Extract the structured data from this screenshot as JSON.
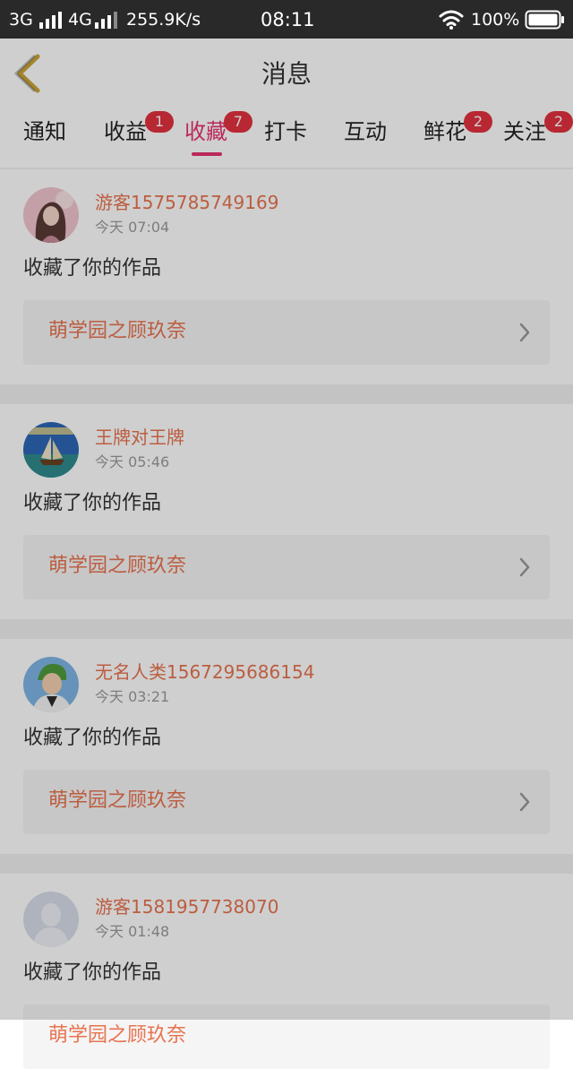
{
  "status_bar": {
    "network_1": "3G",
    "network_2": "4G",
    "speed": "255.9K/s",
    "time": "08:11",
    "battery": "100%"
  },
  "header": {
    "title": "消息",
    "back_icon": "chevron-left-icon"
  },
  "tabs": [
    {
      "label": "通知",
      "badge": "",
      "active": false
    },
    {
      "label": "收益",
      "badge": "1",
      "active": false
    },
    {
      "label": "收藏",
      "badge": "7",
      "active": true
    },
    {
      "label": "打卡",
      "badge": "",
      "active": false
    },
    {
      "label": "互动",
      "badge": "",
      "active": false
    },
    {
      "label": "鲜花",
      "badge": "2",
      "active": false
    },
    {
      "label": "关注",
      "badge": "2",
      "active": false
    }
  ],
  "notifications": [
    {
      "user": "游客1575785749169",
      "time": "今天 07:04",
      "action": "收藏了你的作品",
      "work": "萌学园之顾玖奈",
      "avatar": "girl-photo-avatar"
    },
    {
      "user": "王牌对王牌",
      "time": "今天 05:46",
      "action": "收藏了你的作品",
      "work": "萌学园之顾玖奈",
      "avatar": "sailing-ship-avatar"
    },
    {
      "user": "无名人类1567295686154",
      "time": "今天 03:21",
      "action": "收藏了你的作品",
      "work": "萌学园之顾玖奈",
      "avatar": "anime-character-avatar"
    },
    {
      "user": "游客1581957738070",
      "time": "今天 01:48",
      "action": "收藏了你的作品",
      "work": "萌学园之顾玖奈",
      "avatar": "default-user-avatar"
    }
  ],
  "colors": {
    "accent": "#e6336f",
    "badge": "#e2323e",
    "username": "#e8734f",
    "status_bar": "#292929"
  }
}
